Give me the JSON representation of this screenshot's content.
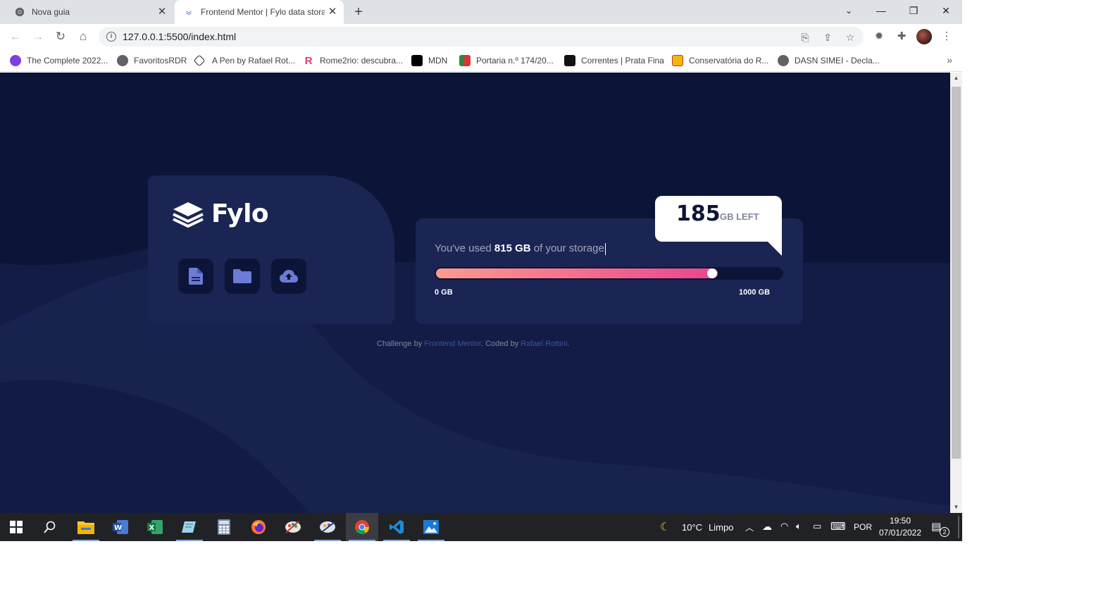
{
  "browser": {
    "tabs": [
      {
        "title": "Nova guia",
        "close": "✕"
      },
      {
        "title": "Frontend Mentor | Fylo data storage component",
        "close": "✕"
      }
    ],
    "new_tab": "+",
    "window_controls": {
      "minimize": "—",
      "restore": "❐",
      "close": "✕"
    },
    "url": "127.0.0.1:5500/index.html",
    "bookmarks": [
      {
        "label": "The Complete 2022...",
        "color": "#7b3fe4"
      },
      {
        "label": "FavoritosRDR",
        "color": "#5f6368"
      },
      {
        "label": "A Pen by Rafael Rot...",
        "color": "#202124"
      },
      {
        "label": "Rome2rio: descubra...",
        "color": "#e03c6e"
      },
      {
        "label": "MDN",
        "color": "#000000"
      },
      {
        "label": "Portaria n.º 174/20...",
        "color": "#d33"
      },
      {
        "label": "Correntes | Prata Fina",
        "color": "#111111"
      },
      {
        "label": "Conservatória do R...",
        "color": "#f2b705"
      },
      {
        "label": "DASN SIMEI - Decla...",
        "color": "#5f6368"
      }
    ],
    "bookmarks_more": "»"
  },
  "page": {
    "logo": "Fylo",
    "storage": {
      "prefix": "You've used ",
      "used": "815 GB",
      "suffix": " of your storage",
      "min_label": "0 GB",
      "max_label": "1000 GB",
      "used_fraction": 0.815,
      "left_value": "185",
      "left_unit": "GB LEFT"
    },
    "attribution": {
      "prefix": "Challenge by ",
      "link1": "Frontend Mentor",
      "middle": ". Coded by ",
      "link2": "Rafael Rottini",
      "suffix": "."
    },
    "colors": {
      "bg_dark": "#0c1537",
      "card": "#1b2553",
      "gradient_start": "#fd9a8d",
      "gradient_end": "#e9458f",
      "icon": "#6b7bd6"
    }
  },
  "taskbar": {
    "weather_temp": "10°C",
    "weather_text": "Limpo",
    "language": "POR",
    "time": "19:50",
    "date": "07/01/2022",
    "notifications": "2"
  }
}
